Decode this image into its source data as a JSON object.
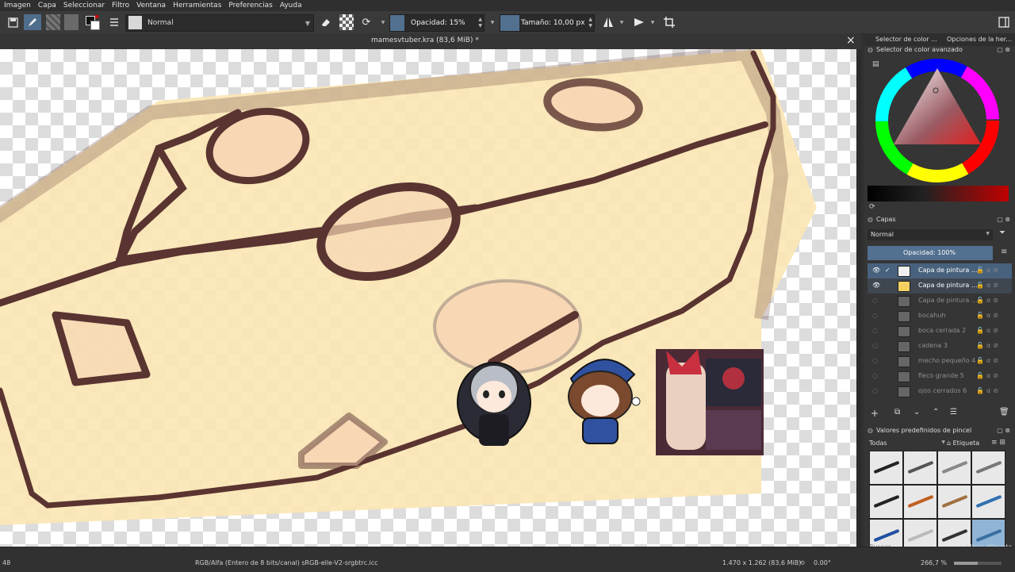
{
  "menu": [
    "Imagen",
    "Capa",
    "Seleccionar",
    "Filtro",
    "Ventana",
    "Herramientas",
    "Preferencias",
    "Ayuda"
  ],
  "toolbar": {
    "blend_mode": "Normal",
    "opacity_label": "Opacidad: 15%",
    "opacity_fraction": 0.15,
    "size_label": "Tamaño: 10,00 px",
    "icons": [
      "save-icon",
      "brush-edit-icon",
      "pattern-icon",
      "gradient-icon",
      "color-swap-icon",
      "brush-settings-icon",
      "brush-preset-icon",
      "eraser-icon",
      "alpha-lock-icon",
      "reload-icon",
      "mirror-horizontal-icon",
      "mirror-vertical-icon",
      "wrap-icon",
      "layout-icon"
    ]
  },
  "document": {
    "tab_title": "mamesvtuber.kra (83,6 MiB) *"
  },
  "docker": {
    "tab_color": "Selector de color ...",
    "tab_tool": "Opciones de la her...",
    "color_panel_title": "Selector de color avanzado",
    "layers_panel_title": "Capas",
    "layers_blend": "Normal",
    "layers_opacity": "Opacidad:  100%",
    "layers": [
      {
        "name": "Capa de pintura ...",
        "visible": true,
        "state": "selected"
      },
      {
        "name": "Capa de pintura ...",
        "visible": true,
        "state": "active"
      },
      {
        "name": "Capa de pintura ...",
        "visible": false,
        "state": ""
      },
      {
        "name": "bocahuh",
        "visible": false,
        "state": ""
      },
      {
        "name": "boca cerrada 2",
        "visible": false,
        "state": ""
      },
      {
        "name": "cadena 3",
        "visible": false,
        "state": ""
      },
      {
        "name": "mecho pequeño 4",
        "visible": false,
        "state": ""
      },
      {
        "name": "fleco grande 5",
        "visible": false,
        "state": ""
      },
      {
        "name": "ojos cerrados 6",
        "visible": false,
        "state": ""
      }
    ],
    "brush_panel_title": "Valores predefinidos de pincel",
    "brush_filter_all": "Todas",
    "brush_tag_label": "Etiqueta",
    "brush_search_placeholder": "Buscar",
    "brush_filter_tag": "Filtrar etiqueta"
  },
  "status": {
    "left": "48",
    "color_space": "RGB/Alfa (Entero de 8 bits/canal)  sRGB-elle-V2-srgbtrc.icc",
    "dimensions": "1.470 x 1.262 (83,6 MiB)",
    "rotation": "0.00°",
    "zoom": "266,7 %"
  },
  "colors": {
    "accent": "#52708f",
    "line": "#5a3430",
    "fill": "#fbe6b4"
  }
}
